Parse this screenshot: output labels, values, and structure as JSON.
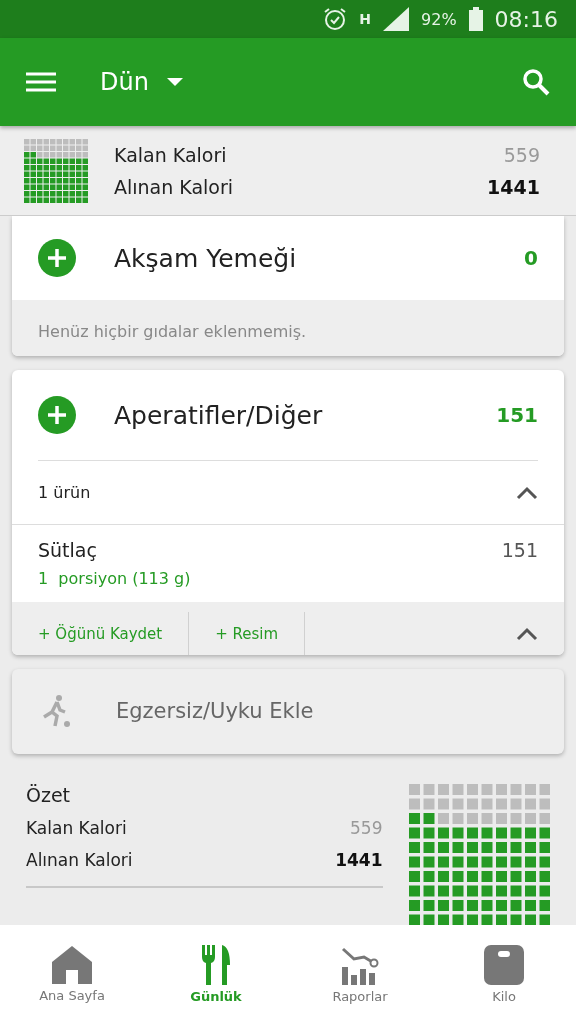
{
  "status_bar": {
    "network": "H",
    "battery": "92%",
    "time": "08:16"
  },
  "toolbar": {
    "title": "Dün"
  },
  "calorie_strip": {
    "rows": [
      {
        "label": "Kalan Kalori",
        "value": "559",
        "kind": "remaining"
      },
      {
        "label": "Alınan Kalori",
        "value": "1441",
        "kind": "consumed"
      }
    ]
  },
  "meals": [
    {
      "name": "Akşam Yemeği",
      "calories": "0",
      "note": "Henüz hiçbir gıdalar eklenmemiş."
    },
    {
      "name": "Aperatifler/Diğer",
      "calories": "151",
      "item_count": "1 ürün",
      "expanded": true,
      "items": [
        {
          "name": "Sütlaç",
          "portion": "1  porsiyon (113 g)",
          "calories": "151"
        }
      ],
      "actions": [
        "+ Öğünü Kaydet",
        "+ Resim"
      ]
    }
  ],
  "exercise": {
    "label": "Egzersiz/Uyku Ekle"
  },
  "summary": {
    "title": "Özet",
    "rows": [
      {
        "label": "Kalan Kalori",
        "value": "559",
        "kind": "remaining"
      },
      {
        "label": "Alınan Kalori",
        "value": "1441",
        "kind": "consumed"
      }
    ]
  },
  "bottom_nav": [
    {
      "label": "Ana Sayfa",
      "kind": "home",
      "selected": false
    },
    {
      "label": "Günlük",
      "kind": "diary",
      "selected": true
    },
    {
      "label": "Raporlar",
      "kind": "reports",
      "selected": false
    },
    {
      "label": "Kilo",
      "kind": "weight",
      "selected": false
    }
  ]
}
